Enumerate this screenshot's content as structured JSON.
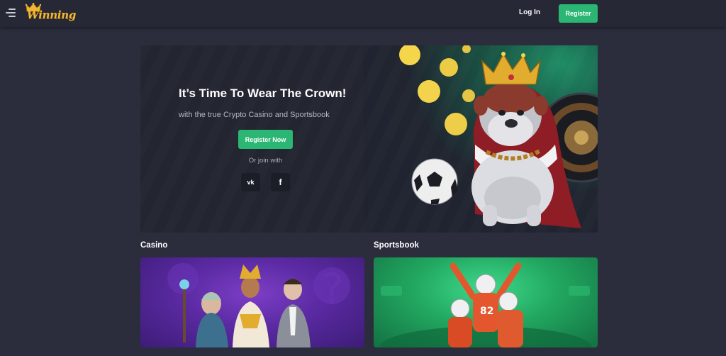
{
  "header": {
    "logo_text": "Winning",
    "login_label": "Log In",
    "register_label": "Register"
  },
  "hero": {
    "title": "It’s Time To Wear The Crown!",
    "subtitle": "with the true Crypto Casino and Sportsbook",
    "cta_label": "Register Now",
    "join_text": "Or join with",
    "social": [
      {
        "icon": "vk-icon",
        "glyph": "vk"
      },
      {
        "icon": "facebook-icon",
        "glyph": "f"
      }
    ]
  },
  "sections": [
    {
      "title": "Casino"
    },
    {
      "title": "Sportsbook"
    }
  ],
  "colors": {
    "background": "#2b2d3c",
    "header": "#262836",
    "accent_green": "#2bb673",
    "logo_gold": "#f2b633"
  }
}
